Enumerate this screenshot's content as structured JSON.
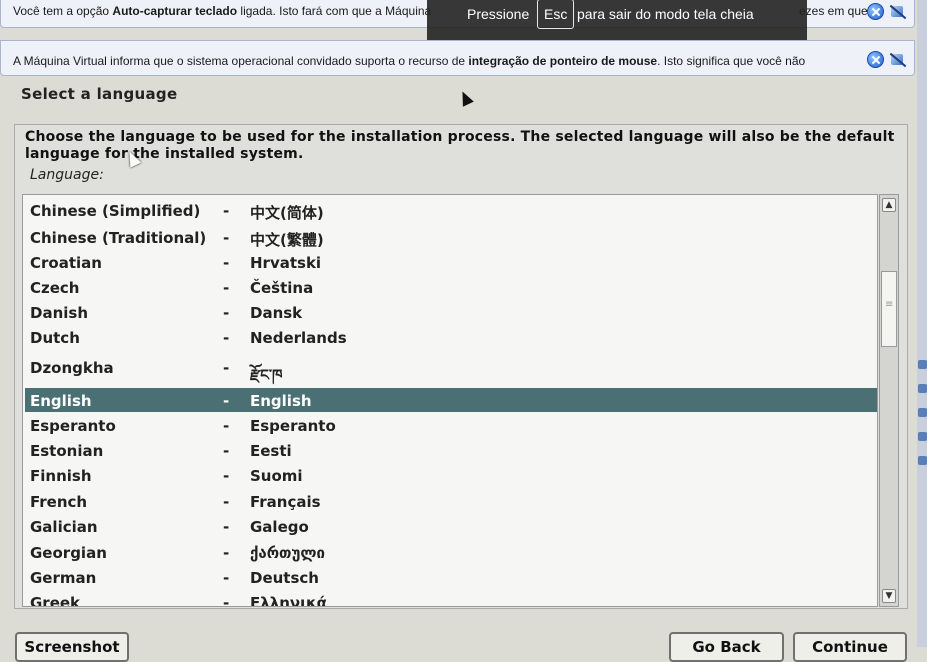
{
  "notifications": {
    "autocapture": {
      "prefix": "Você tem a opção ",
      "bold": "Auto-capturar teclado",
      "suffix": " ligada. Isto fará com que a Máquina",
      "tail": "ezes em que a"
    },
    "mouse_integration": {
      "prefix": "A Máquina Virtual informa que o sistema operacional convidado suporta o recurso de ",
      "bold": "integração de ponteiro de mouse",
      "suffix": ". Isto significa que você não"
    }
  },
  "fullscreen_banner": {
    "press": "Pressione",
    "key": "Esc",
    "message": "para sair do modo tela cheia"
  },
  "background_logo": "debian",
  "installer": {
    "title": "Select a language",
    "prompt": "Choose the language to be used for the installation process. The selected language will also be the default language for the installed system.",
    "field_label": "Language:",
    "languages": [
      {
        "name": "Chinese (Simplified)",
        "sep": "-",
        "native": "中文(简体)"
      },
      {
        "name": "Chinese (Traditional)",
        "sep": "-",
        "native": "中文(繁體)"
      },
      {
        "name": "Croatian",
        "sep": "-",
        "native": "Hrvatski"
      },
      {
        "name": "Czech",
        "sep": "-",
        "native": "Čeština"
      },
      {
        "name": "Danish",
        "sep": "-",
        "native": "Dansk"
      },
      {
        "name": "Dutch",
        "sep": "-",
        "native": "Nederlands"
      },
      {
        "name": "Dzongkha",
        "sep": "-",
        "native": "རྫོང་ཁ"
      },
      {
        "name": "English",
        "sep": "-",
        "native": "English",
        "selected": true
      },
      {
        "name": "Esperanto",
        "sep": "-",
        "native": "Esperanto"
      },
      {
        "name": "Estonian",
        "sep": "-",
        "native": "Eesti"
      },
      {
        "name": "Finnish",
        "sep": "-",
        "native": "Suomi"
      },
      {
        "name": "French",
        "sep": "-",
        "native": "Français"
      },
      {
        "name": "Galician",
        "sep": "-",
        "native": "Galego"
      },
      {
        "name": "Georgian",
        "sep": "-",
        "native": "ქართული"
      },
      {
        "name": "German",
        "sep": "-",
        "native": "Deutsch"
      },
      {
        "name": "Greek",
        "sep": "-",
        "native": "Ελληνικά"
      }
    ],
    "buttons": {
      "screenshot": "Screenshot",
      "go_back": "Go Back",
      "continue": "Continue"
    }
  },
  "colors": {
    "selection": "#4a7073",
    "notification_bg": "#eef2f8",
    "banner_bg": "#222222"
  }
}
